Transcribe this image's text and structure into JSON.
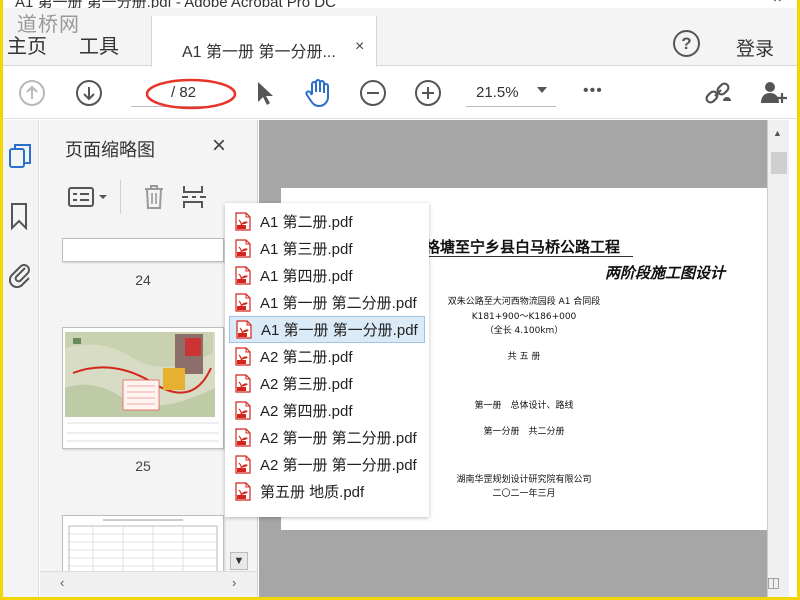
{
  "window": {
    "title": "A1 第一册 第一分册.pdf - Adobe Acrobat Pro DC",
    "watermark": "道桥网"
  },
  "menubar": {
    "home": "主页",
    "tools": "工具",
    "tab_label": "A1 第一册 第一分册...",
    "tab_close": "×",
    "help": "?",
    "login": "登录"
  },
  "toolbar": {
    "page_count": "/ 82",
    "zoom": "21.5%",
    "more": "•••"
  },
  "sidebar": {
    "title": "页面缩略图",
    "close": "×",
    "thumbs": [
      {
        "page": "24"
      },
      {
        "page": "25"
      }
    ]
  },
  "file_menu": {
    "items": [
      {
        "label": "A1 第二册.pdf"
      },
      {
        "label": "A1 第三册.pdf"
      },
      {
        "label": "A1 第四册.pdf"
      },
      {
        "label": "A1 第一册 第二分册.pdf"
      },
      {
        "label": "A1 第一册 第一分册.pdf",
        "selected": true
      },
      {
        "label": "A2 第二册.pdf"
      },
      {
        "label": "A2 第三册.pdf"
      },
      {
        "label": "A2 第四册.pdf"
      },
      {
        "label": "A2 第一册 第二分册.pdf"
      },
      {
        "label": "A2 第一册 第一分册.pdf"
      },
      {
        "label": "第五册 地质.pdf"
      }
    ]
  },
  "document": {
    "title": "格塘至宁乡县白马桥公路工程",
    "subtitle": "两阶段施工图设计",
    "line1": "双朱公路至大河西物流园段 A1 合同段",
    "line2": "K181+900～K186+000",
    "line3": "（全长 4.100km）",
    "line4": "共 五 册",
    "line5": "第一册　总体设计、路线",
    "line6": "第一分册　共二分册",
    "line7": "湖南华罡规划设计研究院有限公司",
    "line8": "二〇二一年三月"
  },
  "colors": {
    "frame": "#f2d600",
    "accent_blue": "#2a6fcc",
    "annotation_red": "#e8342a",
    "pdf_red": "#d4251c"
  }
}
